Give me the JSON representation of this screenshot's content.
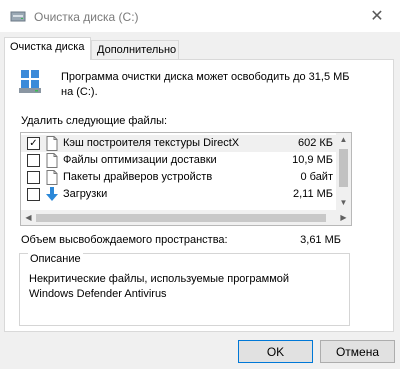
{
  "window": {
    "title": "Очистка диска  (C:)",
    "close_glyph": "✕"
  },
  "tabs": [
    {
      "label": "Очистка диска",
      "active": true
    },
    {
      "label": "Дополнительно",
      "active": false
    }
  ],
  "summary": {
    "icon": "disk-cleanup-icon",
    "text": "Программа очистки диска может освободить до 31,5 МБ на  (C:)."
  },
  "files": {
    "label": "Удалить следующие файлы:",
    "items": [
      {
        "checked": true,
        "checkmark": "✓",
        "label": "Кэш построителя текстуры DirectX",
        "size": "602 КБ",
        "icon": "file-icon"
      },
      {
        "checked": false,
        "checkmark": "",
        "label": "Файлы оптимизации доставки",
        "size": "10,9 МБ",
        "icon": "file-icon"
      },
      {
        "checked": false,
        "checkmark": "",
        "label": "Пакеты драйверов устройств",
        "size": "0 байт",
        "icon": "file-icon"
      },
      {
        "checked": false,
        "checkmark": "",
        "label": "Загрузки",
        "size": "2,11 МБ",
        "icon": "download-arrow-icon"
      }
    ]
  },
  "freed_space": {
    "label": "Объем высвобождаемого пространства:",
    "value": "3,61 МБ"
  },
  "description": {
    "title": "Описание",
    "text": "Некритические файлы, используемые программой Windows Defender Antivirus"
  },
  "buttons": {
    "ok": "OK",
    "cancel": "Отмена"
  },
  "colors": {
    "accent": "#0078d7",
    "window_bg": "#f0f0f0",
    "panel_bg": "#ffffff"
  }
}
